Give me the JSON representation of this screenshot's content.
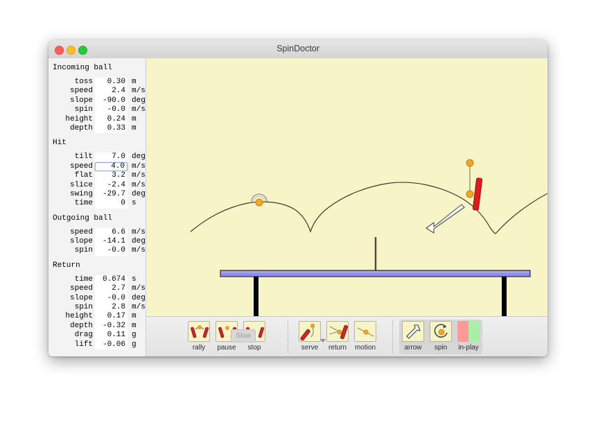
{
  "window": {
    "title": "SpinDoctor",
    "controls": [
      "close",
      "minimize",
      "maximize"
    ]
  },
  "sidebar": {
    "sections": [
      {
        "title": "Incoming ball",
        "rows": [
          {
            "label": "toss",
            "value": "0.30",
            "unit": "m",
            "focused": false
          },
          {
            "label": "speed",
            "value": "2.4",
            "unit": "m/s",
            "focused": false
          },
          {
            "label": "slope",
            "value": "-90.0",
            "unit": "deg",
            "focused": false
          },
          {
            "label": "spin",
            "value": "-0.0",
            "unit": "m/s",
            "focused": false
          },
          {
            "label": "height",
            "value": "0.24",
            "unit": "m",
            "focused": false
          },
          {
            "label": "depth",
            "value": "0.33",
            "unit": "m",
            "focused": false
          }
        ]
      },
      {
        "title": "Hit",
        "rows": [
          {
            "label": "tilt",
            "value": "7.0",
            "unit": "deg",
            "focused": false
          },
          {
            "label": "speed",
            "value": "4.0",
            "unit": "m/s",
            "focused": true
          },
          {
            "label": "flat",
            "value": "3.2",
            "unit": "m/s",
            "focused": false
          },
          {
            "label": "slice",
            "value": "-2.4",
            "unit": "m/s",
            "focused": false
          },
          {
            "label": "swing",
            "value": "-29.7",
            "unit": "deg",
            "focused": false
          },
          {
            "label": "time",
            "value": "0",
            "unit": "s",
            "focused": false
          }
        ]
      },
      {
        "title": "Outgoing ball",
        "rows": [
          {
            "label": "speed",
            "value": "6.6",
            "unit": "m/s",
            "focused": false
          },
          {
            "label": "slope",
            "value": "-14.1",
            "unit": "deg",
            "focused": false
          },
          {
            "label": "spin",
            "value": "-0.0",
            "unit": "m/s",
            "focused": false
          }
        ]
      },
      {
        "title": "Return",
        "rows": [
          {
            "label": "time",
            "value": "0.674",
            "unit": "s",
            "focused": false
          },
          {
            "label": "speed",
            "value": "2.7",
            "unit": "m/s",
            "focused": false
          },
          {
            "label": "slope",
            "value": "-0.0",
            "unit": "deg",
            "focused": false
          },
          {
            "label": "spin",
            "value": "2.8",
            "unit": "m/s",
            "focused": false
          },
          {
            "label": "height",
            "value": "0.17",
            "unit": "m",
            "focused": false
          },
          {
            "label": "depth",
            "value": "-0.32",
            "unit": "m",
            "focused": false
          },
          {
            "label": "drag",
            "value": "0.11",
            "unit": "g",
            "focused": false
          },
          {
            "label": "lift",
            "value": "-0.06",
            "unit": "g",
            "focused": false
          }
        ]
      }
    ]
  },
  "toolbar": {
    "playback": [
      {
        "label": "rally",
        "icon": "paddles-rally-icon"
      },
      {
        "label": "pause",
        "icon": "paddles-pause-icon"
      },
      {
        "label": "stop",
        "icon": "paddles-stop-icon"
      }
    ],
    "slow_label": "Slow",
    "shots": [
      {
        "label": "serve",
        "icon": "serve-paddle-icon",
        "has_menu": true
      },
      {
        "label": "return",
        "icon": "return-paddle-icon",
        "has_menu": false
      },
      {
        "label": "motion",
        "icon": "motion-ball-icon",
        "has_menu": false
      }
    ],
    "tools": [
      {
        "label": "arrow",
        "icon": "arrow-cursor-icon"
      },
      {
        "label": "spin",
        "icon": "spin-ball-icon"
      },
      {
        "label": "in-play",
        "icon": "in-play-swatch-icon"
      }
    ]
  },
  "canvas": {
    "background_color": "#f7f4c8",
    "table_color": "#8f8ceb",
    "paddle_color": "#e11b1b",
    "ball_color": "#f5a623",
    "trajectory_color": "#3a3a28",
    "net_color": "#4a4a30",
    "leg_color": "#000000",
    "arrow_fill": "#ffffff"
  }
}
